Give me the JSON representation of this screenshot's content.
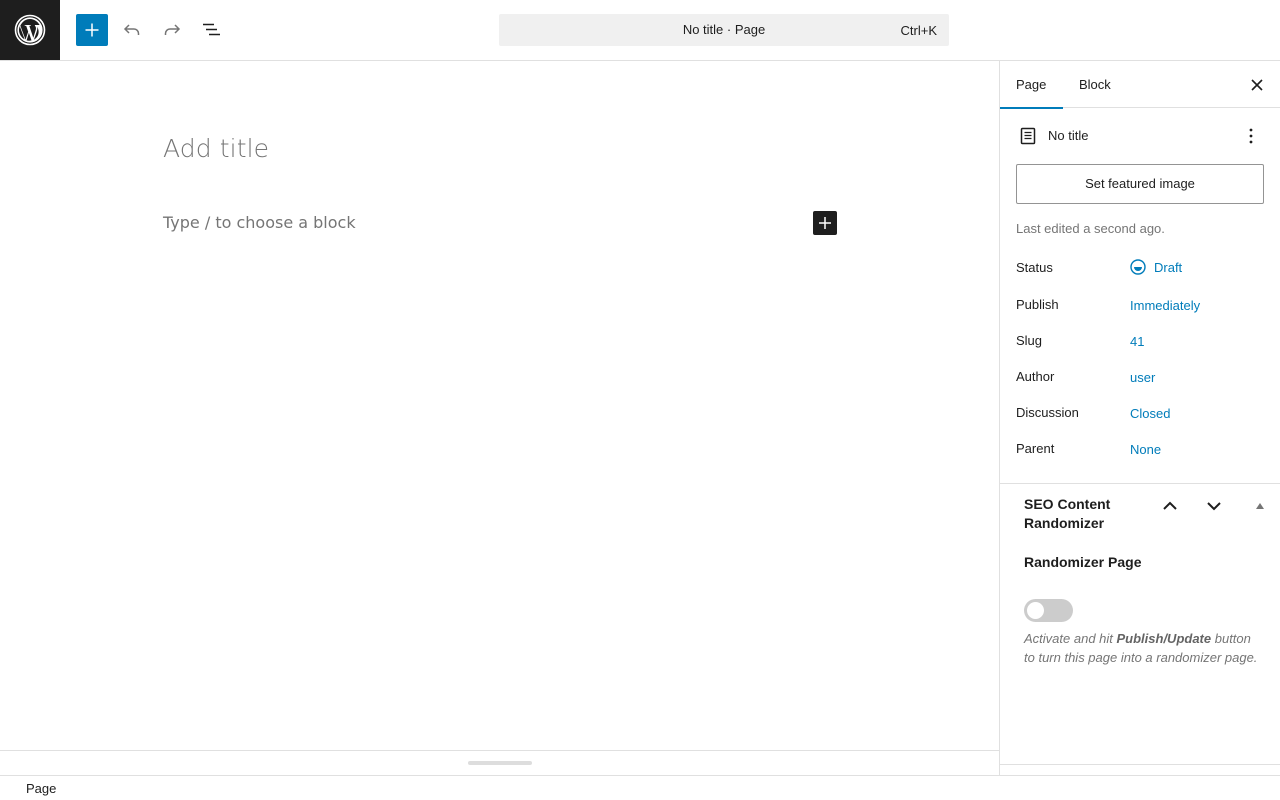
{
  "toolbar": {
    "logo_name": "wordpress-logo",
    "add_block_icon": "plus-icon",
    "undo_icon": "undo-icon",
    "redo_icon": "redo-icon",
    "outline_icon": "list-view-icon",
    "command_title": "No title · Page",
    "command_shortcut": "Ctrl+K"
  },
  "editor": {
    "title_placeholder": "Add title",
    "block_placeholder": "Type / to choose a block"
  },
  "footer": {
    "breadcrumb": "Page"
  },
  "sidebar": {
    "tabs": [
      {
        "label": "Page",
        "active": true
      },
      {
        "label": "Block",
        "active": false
      }
    ],
    "doc_title": "No title",
    "featured_image_label": "Set featured image",
    "last_edited": "Last edited a second ago.",
    "properties": [
      {
        "label": "Status",
        "value": "Draft"
      },
      {
        "label": "Publish",
        "value": "Immediately"
      },
      {
        "label": "Slug",
        "value": "41"
      },
      {
        "label": "Author",
        "value": "user"
      },
      {
        "label": "Discussion",
        "value": "Closed"
      },
      {
        "label": "Parent",
        "value": "None"
      }
    ],
    "seo_panel": {
      "title": "SEO Content Randomizer",
      "heading": "Randomizer Page",
      "toggle_on": false,
      "desc_prefix": "Activate and hit ",
      "desc_bold": "Publish/Update",
      "desc_suffix": " button to turn this page into a randomizer page."
    }
  },
  "colors": {
    "accent": "#007cba",
    "dark": "#1e1e1e",
    "muted": "#757575"
  }
}
